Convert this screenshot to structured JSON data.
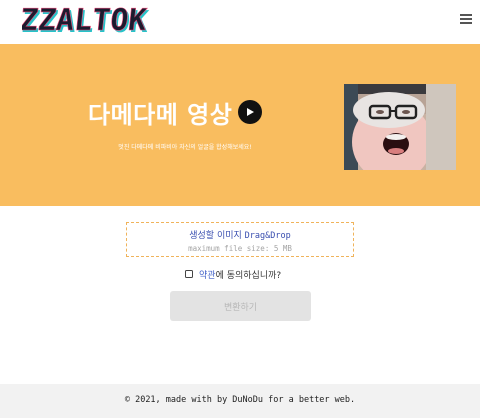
{
  "header": {
    "logo_text": "ZZALTOK",
    "menu_icon": "hamburger-menu-icon"
  },
  "hero": {
    "title": "다메다메 영상",
    "play_icon": "play-icon",
    "subtitle": "멋진 다메다메 비파비아 자신의 얼굴을 합성해보세요!",
    "background_color": "#f9bd5f"
  },
  "upload": {
    "label": "생성할 이미지",
    "drag_label": "Drag&Drop",
    "size_hint": "maximum file size: 5 MB"
  },
  "terms": {
    "checked": false,
    "link_text": "약관",
    "suffix_text": "에 동의하십니까?"
  },
  "convert_button": {
    "label": "변환하기",
    "enabled": false
  },
  "footer": {
    "text": "© 2021, made with by DuNoDu for a better web."
  },
  "colors": {
    "accent": "#f9bd5f",
    "link": "#3a4fb0",
    "button_disabled_bg": "#e3e3e3"
  }
}
